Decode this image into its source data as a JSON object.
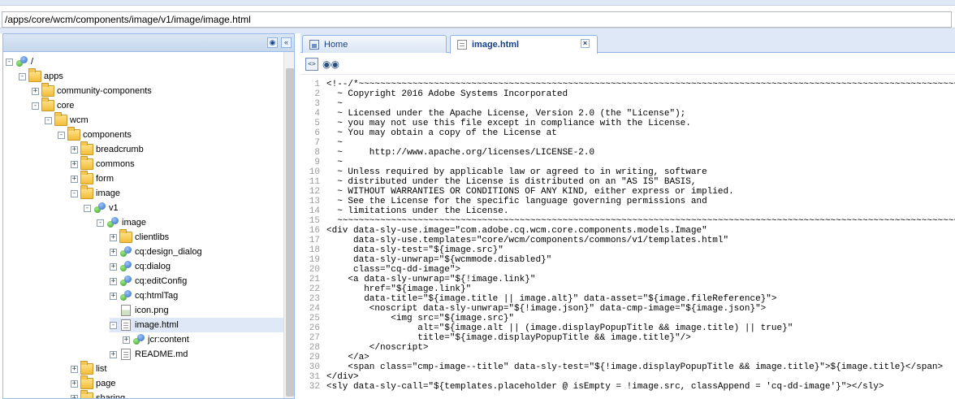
{
  "path_bar": {
    "value": "/apps/core/wcm/components/image/v1/image/image.html"
  },
  "left_panel": {
    "header_icons": [
      "binoculars-icon",
      "collapse-left-icon"
    ],
    "tree": [
      {
        "label": "/",
        "indent": 0,
        "toggle": "-",
        "icon": "node"
      },
      {
        "label": "apps",
        "indent": 1,
        "toggle": "-",
        "icon": "folder"
      },
      {
        "label": "community-components",
        "indent": 2,
        "toggle": "+",
        "icon": "folder"
      },
      {
        "label": "core",
        "indent": 2,
        "toggle": "-",
        "icon": "folder"
      },
      {
        "label": "wcm",
        "indent": 3,
        "toggle": "-",
        "icon": "folder"
      },
      {
        "label": "components",
        "indent": 4,
        "toggle": "-",
        "icon": "folder"
      },
      {
        "label": "breadcrumb",
        "indent": 5,
        "toggle": "+",
        "icon": "folder"
      },
      {
        "label": "commons",
        "indent": 5,
        "toggle": "+",
        "icon": "folder"
      },
      {
        "label": "form",
        "indent": 5,
        "toggle": "+",
        "icon": "folder"
      },
      {
        "label": "image",
        "indent": 5,
        "toggle": "-",
        "icon": "folder"
      },
      {
        "label": "v1",
        "indent": 6,
        "toggle": "-",
        "icon": "node"
      },
      {
        "label": "image",
        "indent": 7,
        "toggle": "-",
        "icon": "node"
      },
      {
        "label": "clientlibs",
        "indent": 8,
        "toggle": "+",
        "icon": "folder"
      },
      {
        "label": "cq:design_dialog",
        "indent": 8,
        "toggle": "+",
        "icon": "node"
      },
      {
        "label": "cq:dialog",
        "indent": 8,
        "toggle": "+",
        "icon": "node"
      },
      {
        "label": "cq:editConfig",
        "indent": 8,
        "toggle": "+",
        "icon": "node"
      },
      {
        "label": "cq:htmlTag",
        "indent": 8,
        "toggle": "+",
        "icon": "node"
      },
      {
        "label": "icon.png",
        "indent": 8,
        "toggle": "",
        "icon": "image-file"
      },
      {
        "label": "image.html",
        "indent": 8,
        "toggle": "-",
        "icon": "file",
        "selected": true
      },
      {
        "label": "jcr:content",
        "indent": 9,
        "toggle": "+",
        "icon": "node"
      },
      {
        "label": "README.md",
        "indent": 8,
        "toggle": "+",
        "icon": "file"
      },
      {
        "label": "list",
        "indent": 5,
        "toggle": "+",
        "icon": "folder"
      },
      {
        "label": "page",
        "indent": 5,
        "toggle": "+",
        "icon": "folder"
      },
      {
        "label": "sharing",
        "indent": 5,
        "toggle": "+",
        "icon": "folder"
      }
    ]
  },
  "tabs": [
    {
      "label": "Home",
      "icon": "home-icon",
      "active": false
    },
    {
      "label": "image.html",
      "icon": "document-icon",
      "active": true,
      "closable": true
    }
  ],
  "toolbar": {
    "icons": [
      "format-icon",
      "binoculars-icon"
    ]
  },
  "code_lines": [
    "<!--/*~~~~~~~~~~~~~~~~~~~~~~~~~~~~~~~~~~~~~~~~~~~~~~~~~~~~~~~~~~~~~~~~~~~~~~~~~~~~~~~~~~~~~~~~~~~~~~~~~~~~~~~~~~~~~~~~~~~~~~",
    "  ~ Copyright 2016 Adobe Systems Incorporated",
    "  ~",
    "  ~ Licensed under the Apache License, Version 2.0 (the \"License\");",
    "  ~ you may not use this file except in compliance with the License.",
    "  ~ You may obtain a copy of the License at",
    "  ~",
    "  ~     http://www.apache.org/licenses/LICENSE-2.0",
    "  ~",
    "  ~ Unless required by applicable law or agreed to in writing, software",
    "  ~ distributed under the License is distributed on an \"AS IS\" BASIS,",
    "  ~ WITHOUT WARRANTIES OR CONDITIONS OF ANY KIND, either express or implied.",
    "  ~ See the License for the specific language governing permissions and",
    "  ~ limitations under the License.",
    "  ~~~~~~~~~~~~~~~~~~~~~~~~~~~~~~~~~~~~~~~~~~~~~~~~~~~~~~~~~~~~~~~~~~~~~~~~~~~~~~~~~~~~~~~~~~~~~~~~~~~~~~~~~~~~~~~~~~~~~~*/-->",
    "<div data-sly-use.image=\"com.adobe.cq.wcm.core.components.models.Image\"",
    "     data-sly-use.templates=\"core/wcm/components/commons/v1/templates.html\"",
    "     data-sly-test=\"${image.src}\"",
    "     data-sly-unwrap=\"${wcmmode.disabled}\"",
    "     class=\"cq-dd-image\">",
    "    <a data-sly-unwrap=\"${!image.link}\"",
    "       href=\"${image.link}\"",
    "       data-title=\"${image.title || image.alt}\" data-asset=\"${image.fileReference}\">",
    "        <noscript data-sly-unwrap=\"${!image.json}\" data-cmp-image=\"${image.json}\">",
    "            <img src=\"${image.src}\"",
    "                 alt=\"${image.alt || (image.displayPopupTitle && image.title) || true}\"",
    "                 title=\"${image.displayPopupTitle && image.title}\"/>",
    "        </noscript>",
    "    </a>",
    "    <span class=\"cmp-image--title\" data-sly-test=\"${!image.displayPopupTitle && image.title}\">${image.title}</span>",
    "</div>",
    "<sly data-sly-call=\"${templates.placeholder @ isEmpty = !image.src, classAppend = 'cq-dd-image'}\"></sly>"
  ]
}
